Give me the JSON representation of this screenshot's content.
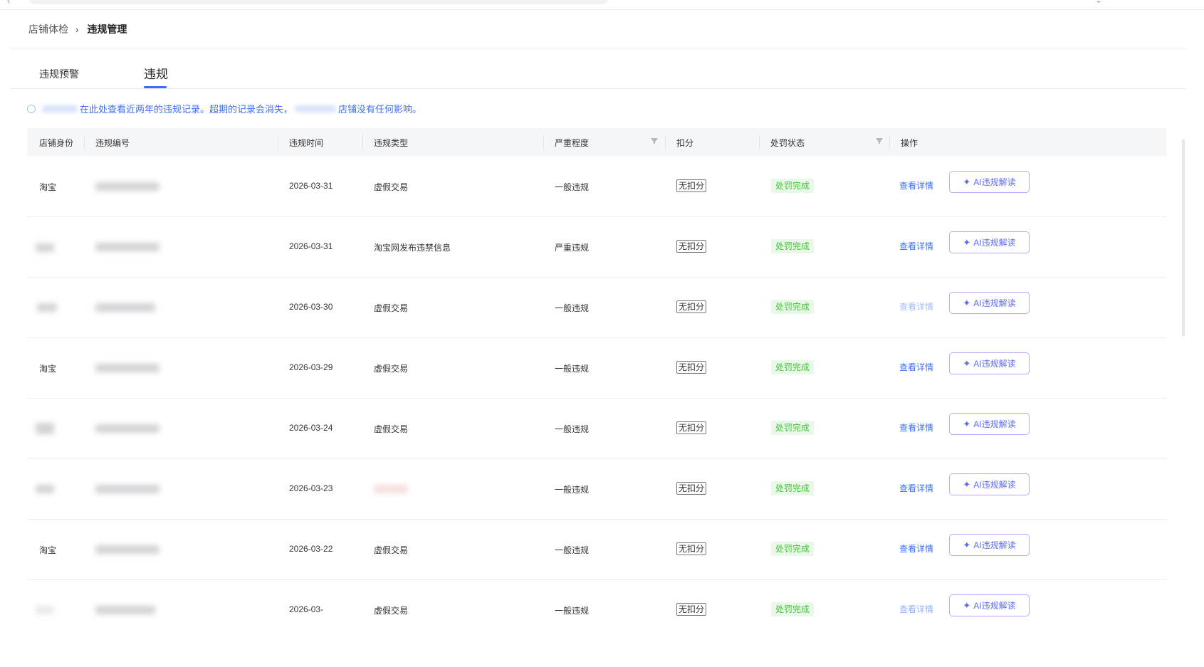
{
  "breadcrumb": {
    "parent": "店铺体检",
    "separator": "›",
    "current": "违规管理"
  },
  "tabs": [
    {
      "label": "违规预警",
      "active": false
    },
    {
      "label": "违规",
      "active": true
    }
  ],
  "notice": {
    "text_part1": "在此处查看近两年的违规记录。超期的记录会消失，",
    "text_part2": "店铺没有任何影响。"
  },
  "table": {
    "headers": {
      "shop_identity": "店铺身份",
      "violation_no": "违规编号",
      "violation_time": "违规时间",
      "violation_type": "违规类型",
      "severity": "严重程度",
      "deduction": "扣分",
      "penalty_status": "处罚状态",
      "actions": "操作"
    },
    "rows": [
      {
        "shop": "淘宝",
        "date": "2026-03-31",
        "type": "虚假交易",
        "severity": "一般违规",
        "deduction": "无扣分",
        "status": "处罚完成",
        "detail": "查看详情",
        "ai": "AI违规解读"
      },
      {
        "shop": "",
        "date": "2026-03-31",
        "type": "淘宝网发布违禁信息",
        "severity": "严重违规",
        "deduction": "无扣分",
        "status": "处罚完成",
        "detail": "查看详情",
        "ai": "AI违规解读"
      },
      {
        "shop": "",
        "date": "2026-03-30",
        "type": "虚假交易",
        "severity": "一般违规",
        "deduction": "无扣分",
        "status": "处罚完成",
        "detail": "查看详情",
        "ai": "AI违规解读"
      },
      {
        "shop": "淘宝",
        "date": "2026-03-29",
        "type": "虚假交易",
        "severity": "一般违规",
        "deduction": "无扣分",
        "status": "处罚完成",
        "detail": "查看详情",
        "ai": "AI违规解读"
      },
      {
        "shop": "",
        "date": "2026-03-24",
        "type": "虚假交易",
        "severity": "一般违规",
        "deduction": "无扣分",
        "status": "处罚完成",
        "detail": "查看详情",
        "ai": "AI违规解读"
      },
      {
        "shop": "",
        "date": "2026-03-23",
        "type": "",
        "severity": "一般违规",
        "deduction": "无扣分",
        "status": "处罚完成",
        "detail": "查看详情",
        "ai": "AI违规解读"
      },
      {
        "shop": "淘宝",
        "date": "2026-03-22",
        "type": "虚假交易",
        "severity": "一般违规",
        "deduction": "无扣分",
        "status": "处罚完成",
        "detail": "查看详情",
        "ai": "AI违规解读"
      },
      {
        "shop": "",
        "date": "2026-03-",
        "type": "虚假交易",
        "severity": "一般违规",
        "deduction": "无扣分",
        "status": "处罚完成",
        "detail": "查看详情",
        "ai": "AI违规解读"
      }
    ]
  },
  "colors": {
    "accent": "#3a6ff7",
    "status_green": "#46c23a",
    "status_bg": "#e9f8e8",
    "ai_border": "#b9a8f5",
    "header_bg": "#f5f6f8"
  },
  "icons": {
    "info": "info-circle-icon",
    "filter": "filter-icon",
    "ai": "sparkle-icon",
    "chevron": "chevron-right-icon"
  }
}
